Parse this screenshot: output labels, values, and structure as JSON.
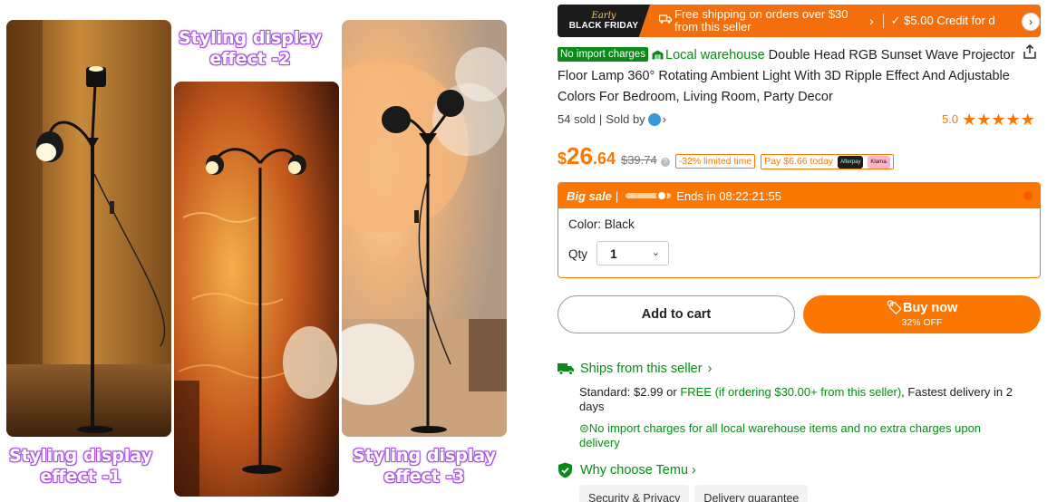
{
  "gallery": {
    "captions": {
      "effect2": "Styling display\neffect -2",
      "effect1": "Styling display\neffect -1",
      "effect3": "Styling display\neffect -3"
    }
  },
  "promo": {
    "early_label": "Early",
    "black_friday_label": "BLACK FRIDAY",
    "shipping_text": "Free shipping on orders over $30 from this seller",
    "arrow": "›",
    "credit_text": "✓ $5.00 Credit for d",
    "next_button": "›"
  },
  "product": {
    "badge": "No import charges",
    "local_label": "Local warehouse",
    "title": "Double Head RGB Sunset Wave Projector Floor Lamp 360° Rotating Ambient Light With 3D Ripple Effect And Adjustable Colors For Bedroom, Living Room, Party Decor",
    "sold": "54 sold",
    "sold_by": "Sold by",
    "seller_chevron": "›",
    "rating": "5.0",
    "stars": "★★★★★",
    "star_count": 5
  },
  "price": {
    "currency": "$",
    "integer": "26",
    "decimals": ".64",
    "original": "$39.74",
    "discount_tag": "-32% limited time",
    "pay_tag": "Pay $6.66 today",
    "afterpay": "Afterpay",
    "klarna": "Klarna."
  },
  "sale": {
    "big_sale": "Big sale",
    "separator": "|",
    "ends": "Ends in 08:22:21:55",
    "color": "Color: Black",
    "qty_label": "Qty",
    "qty_value": "1"
  },
  "actions": {
    "add_to_cart": "Add to cart",
    "buy_now": "Buy now",
    "buy_now_sub": "32% OFF"
  },
  "shipping": {
    "ships_from": "Ships from this seller",
    "standard_prefix": "Standard: $2.99 or ",
    "standard_green": "FREE (if ordering $30.00+ from this seller)",
    "standard_suffix": ", Fastest delivery in 2 days",
    "no_import": "No import charges for all local warehouse items and no extra charges upon delivery",
    "why": "Why choose Temu",
    "chips": [
      "Security & Privacy",
      "Delivery guarantee"
    ]
  },
  "colors": {
    "accent": "#fb7701",
    "green": "#0a8a17",
    "caption_glow": "#b05ee0"
  }
}
